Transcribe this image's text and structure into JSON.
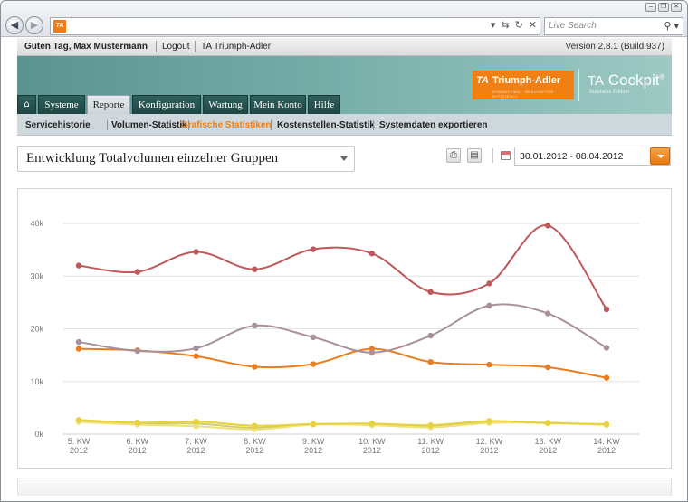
{
  "browser": {
    "search_placeholder": "Live Search",
    "favicon_text": "TA"
  },
  "topbar": {
    "greeting": "Guten Tag, Max Mustermann",
    "logout": "Logout",
    "company": "TA Triumph-Adler",
    "version": "Version 2.8.1 (Build 937)"
  },
  "header": {
    "logo_mark": "TA",
    "logo_name": "Triumph-Adler",
    "logo_tagline": "CONSULTING · REALISATION · EFFICIENCY",
    "product_prefix": "TA",
    "product_name": "Cockpit",
    "product_reg": "®",
    "product_edition": "Business Edition"
  },
  "tabs": [
    {
      "label": "Systeme"
    },
    {
      "label": "Reporte",
      "active": true
    },
    {
      "label": "Konfiguration"
    },
    {
      "label": "Wartung"
    },
    {
      "label": "Mein Konto"
    },
    {
      "label": "Hilfe"
    }
  ],
  "subnav": [
    {
      "label": "Servicehistorie"
    },
    {
      "label": "Volumen-Statistik"
    },
    {
      "label": "Grafische Statistiken",
      "active": true
    },
    {
      "label": "Kostenstellen-Statistik"
    },
    {
      "label": "Systemdaten exportieren"
    }
  ],
  "report": {
    "title": "Entwicklung Totalvolumen einzelner Gruppen",
    "date_range": "30.01.2012 - 08.04.2012"
  },
  "colors": {
    "accent": "#f08013",
    "header_teal": "#5a9490",
    "tab_dark": "#1e4643"
  },
  "chart_data": {
    "type": "line",
    "categories": [
      "5. KW 2012",
      "6. KW 2012",
      "7. KW 2012",
      "8. KW 2012",
      "9. KW 2012",
      "10. KW 2012",
      "11. KW 2012",
      "12. KW 2012",
      "13. KW 2012",
      "14. KW 2012"
    ],
    "x_tick_lines": [
      [
        "5. KW",
        "2012"
      ],
      [
        "6. KW",
        "2012"
      ],
      [
        "7. KW",
        "2012"
      ],
      [
        "8. KW",
        "2012"
      ],
      [
        "9. KW",
        "2012"
      ],
      [
        "10. KW",
        "2012"
      ],
      [
        "11. KW",
        "2012"
      ],
      [
        "12. KW",
        "2012"
      ],
      [
        "13. KW",
        "2012"
      ],
      [
        "14. KW",
        "2012"
      ]
    ],
    "y_ticks": [
      "0k",
      "10k",
      "20k",
      "30k",
      "40k"
    ],
    "ylim": [
      0,
      40000
    ],
    "grid": true,
    "series": [
      {
        "color": "#c0575a",
        "values": [
          32000,
          30800,
          34600,
          31300,
          35100,
          34300,
          27000,
          28600,
          39600,
          23700
        ]
      },
      {
        "color": "#a9919c",
        "values": [
          17500,
          15800,
          16300,
          20600,
          18400,
          15500,
          18700,
          24400,
          22900,
          16400
        ]
      },
      {
        "color": "#ec7c1c",
        "values": [
          16200,
          15900,
          14800,
          12800,
          13300,
          16200,
          13700,
          13200,
          12700,
          10700
        ]
      },
      {
        "color": "#e8d13a",
        "values": [
          2700,
          2200,
          2400,
          1600,
          1900,
          2000,
          1700,
          2500,
          2100,
          1900
        ]
      },
      {
        "color": "#f0e07a",
        "values": [
          2300,
          1800,
          1500,
          900,
          1800,
          1700,
          1300,
          2100,
          2200,
          1700
        ]
      },
      {
        "color": "#cfcf6a",
        "values": [
          2500,
          2000,
          2000,
          1200,
          1900,
          1900,
          1600,
          2200,
          2100,
          1800
        ]
      }
    ]
  }
}
